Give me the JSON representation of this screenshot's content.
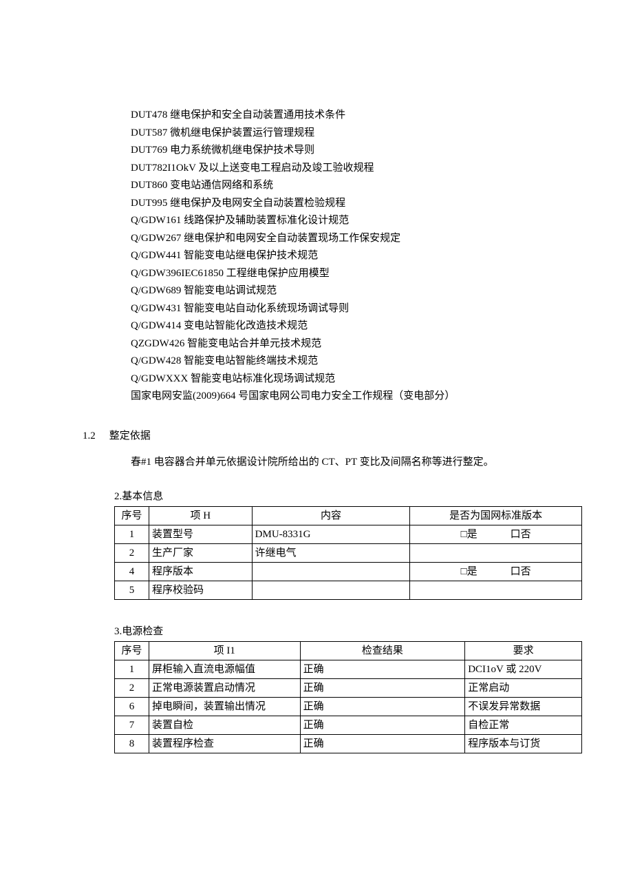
{
  "standards": [
    "DUT478 继电保护和安全自动装置通用技术条件",
    "DUT587 微机继电保护装置运行管理规程",
    "DUT769 电力系统微机继电保护技术导则",
    "DUT782I1OkV 及以上送变电工程启动及竣工验收规程",
    "DUT860 变电站通信网络和系统",
    "DUT995 继电保护及电网安全自动装置检验规程",
    "Q/GDW161 线路保护及辅助装置标准化设计规范",
    "Q/GDW267 继电保护和电网安全自动装置现场工作保安规定",
    "Q/GDW441 智能变电站继电保护技术规范",
    "Q/GDW396IEC61850 工程继电保护应用模型",
    "Q/GDW689 智能变电站调试规范",
    "Q/GDW431 智能变电站自动化系统现场调试导则",
    "Q/GDW414 变电站智能化改造技术规范",
    "QZGDW426 智能变电站合并单元技术规范",
    "Q/GDW428 智能变电站智能终端技术规范",
    "Q/GDWXXX 智能变电站标准化现场调试规范",
    "国家电网安监(2009)664 号国家电网公司电力安全工作规程（变电部分）"
  ],
  "section12": {
    "number": "1.2",
    "title": "整定依据",
    "body": "春#1 电容器合并单元依据设计院所给出的 CT、PT 变比及间隔名称等进行整定。"
  },
  "table1": {
    "title": "2.基本信息",
    "headers": {
      "no": "序号",
      "item": "项 H",
      "content": "内容",
      "std": "是否为国网标准版本"
    },
    "yesLabel": "□是",
    "noLabel": "口否",
    "rows": [
      {
        "no": "1",
        "item": "装置型号",
        "content": "DMU-8331G",
        "yn": true
      },
      {
        "no": "2",
        "item": "生产厂家",
        "content": "许继电气",
        "yn": false
      },
      {
        "no": "4",
        "item": "程序版本",
        "content": "",
        "yn": true
      },
      {
        "no": "5",
        "item": "程序校验码",
        "content": "",
        "yn": false
      }
    ]
  },
  "table2": {
    "title": "3.电源检查",
    "headers": {
      "no": "序号",
      "item": "项 I1",
      "result": "检查结果",
      "req": "要求"
    },
    "rows": [
      {
        "no": "1",
        "item": "屏柜输入直流电源幅值",
        "result": "正确",
        "req": "DCI1oV 或 220V"
      },
      {
        "no": "2",
        "item": "正常电源装置启动情况",
        "result": "正确",
        "req": "正常启动"
      },
      {
        "no": "6",
        "item": "掉电瞬间，装置输出情况",
        "result": "正确",
        "req": "不误发异常数据"
      },
      {
        "no": "7",
        "item": "装置自检",
        "result": "正确",
        "req": "自检正常"
      },
      {
        "no": "8",
        "item": "装置程序检查",
        "result": "正确",
        "req": "程序版本与订货"
      }
    ]
  }
}
